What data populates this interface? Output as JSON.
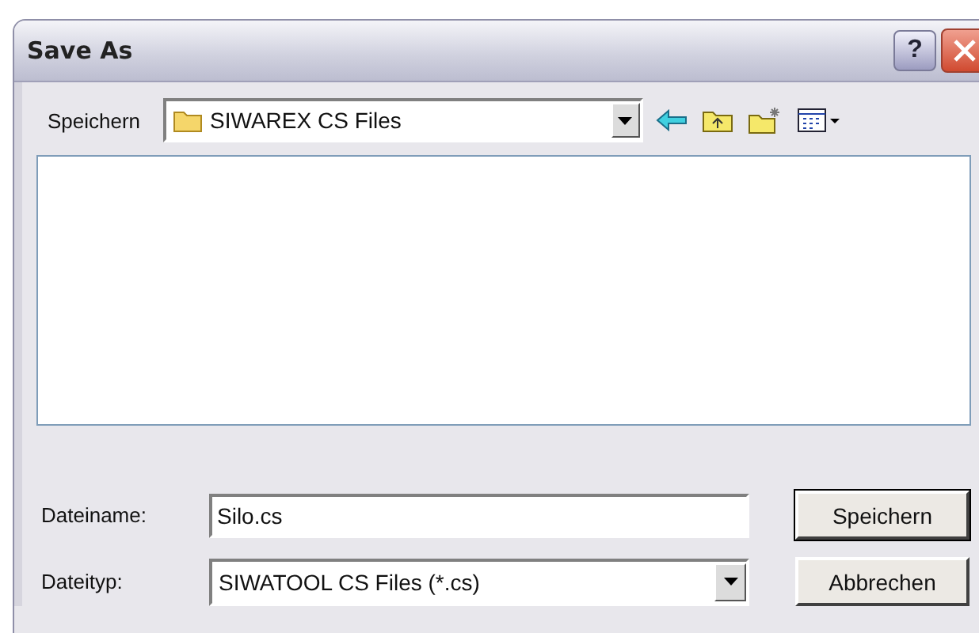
{
  "window": {
    "title": "Save As",
    "help_button": "?"
  },
  "location": {
    "label": "Speichern",
    "value": "SIWAREX CS Files"
  },
  "file_name": {
    "label": "Dateiname:",
    "value": "Silo.cs"
  },
  "file_type": {
    "label": "Dateityp:",
    "value": "SIWATOOL CS Files (*.cs)"
  },
  "buttons": [
    {
      "label": "Speichern",
      "default": true
    },
    {
      "label": "Abbrechen",
      "default": false
    }
  ]
}
